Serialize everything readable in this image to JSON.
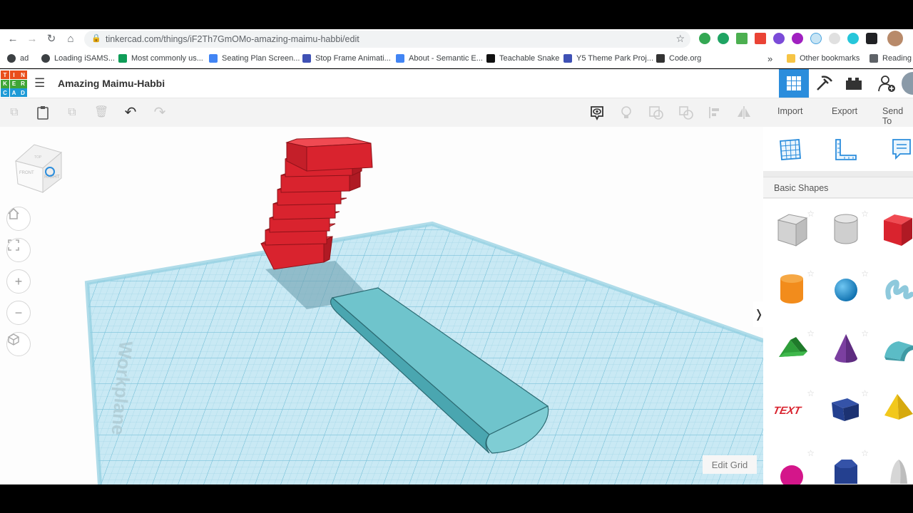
{
  "browser": {
    "url": "tinkercad.com/things/iF2Th7GmOMo-amazing-maimu-habbi/edit",
    "bookmarks": [
      {
        "label": "ad",
        "color": "#3c4043"
      },
      {
        "label": "Loading iSAMS...",
        "color": "#3c4043"
      },
      {
        "label": "Most commonly us...",
        "color": "#0f9d58"
      },
      {
        "label": "Seating Plan Screen...",
        "color": "#4285f4"
      },
      {
        "label": "Stop Frame Animati...",
        "color": "#3f51b5"
      },
      {
        "label": "About - Semantic E...",
        "color": "#4285f4"
      },
      {
        "label": "Teachable Snake",
        "color": "#111111"
      },
      {
        "label": "Y5 Theme Park Proj...",
        "color": "#3f51b5"
      },
      {
        "label": "Code.org",
        "color": "#333333"
      }
    ],
    "overflow": "»",
    "other_bookmarks": "Other bookmarks",
    "reading_list": "Reading l"
  },
  "app": {
    "logo_letters": [
      "T",
      "I",
      "N",
      "K",
      "E",
      "R",
      "C",
      "A",
      "D"
    ],
    "logo_colors": [
      "#e94e1b",
      "#e94e1b",
      "#e94e1b",
      "#3fa535",
      "#3fa535",
      "#3fa535",
      "#1d9ad6",
      "#1d9ad6",
      "#1d9ad6"
    ],
    "design_name": "Amazing Maimu-Habbi",
    "accent": "#2b8ddc"
  },
  "toolbar": {
    "import_label": "Import",
    "export_label": "Export",
    "send_to_label": "Send To"
  },
  "workplane": {
    "watermark": "Workplane",
    "edit_grid_label": "Edit Grid",
    "viewcube_labels": [
      "FRONT",
      "RIGHT",
      "TOP"
    ],
    "grid_color": "#a8d8ea",
    "brick_color": "#d9232e",
    "roof_color": "#6fc4cc"
  },
  "panel": {
    "category": "Basic Shapes",
    "shapes": [
      {
        "name": "box-striped",
        "color": "#c8c8c8"
      },
      {
        "name": "cylinder-striped",
        "color": "#c8c8c8"
      },
      {
        "name": "box",
        "color": "#d9232e"
      },
      {
        "name": "cylinder",
        "color": "#f28c1c"
      },
      {
        "name": "sphere",
        "color": "#1c8fd0"
      },
      {
        "name": "scribble",
        "color": "#8ec9dc"
      },
      {
        "name": "roof",
        "color": "#2e9e3a"
      },
      {
        "name": "cone",
        "color": "#7b3fa0"
      },
      {
        "name": "round-roof",
        "color": "#5bbcc6"
      },
      {
        "name": "text",
        "color": "#d9232e"
      },
      {
        "name": "cube-blue",
        "color": "#24408f"
      },
      {
        "name": "pyramid",
        "color": "#f2c81c"
      },
      {
        "name": "sphere-half",
        "color": "#d4168a"
      },
      {
        "name": "polygon",
        "color": "#24408f"
      },
      {
        "name": "paraboloid",
        "color": "#d6d6d6"
      }
    ]
  }
}
